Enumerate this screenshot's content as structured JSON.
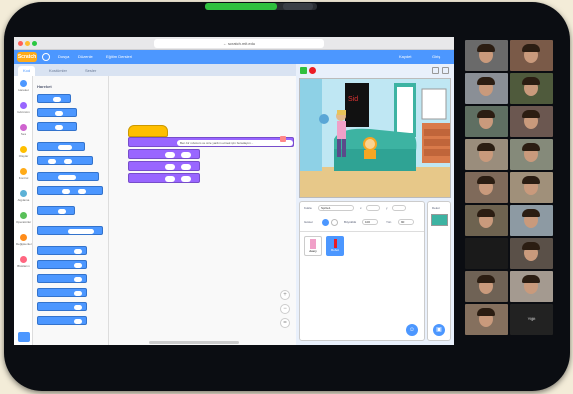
{
  "browser": {
    "url": "← scratch.mit.edu"
  },
  "menubar": {
    "logo": "Scratch",
    "items": [
      "Dosya",
      "Düzenle",
      "Eğitim Dersleri"
    ],
    "right_items": [
      "Kaydet",
      "Giriş"
    ]
  },
  "tabs": [
    "Kod",
    "Kostümler",
    "Sesler"
  ],
  "categories": [
    {
      "name": "Hareket",
      "color": "#4c97ff"
    },
    {
      "name": "Görünüm",
      "color": "#9966ff"
    },
    {
      "name": "Ses",
      "color": "#cf63cf"
    },
    {
      "name": "Olaylar",
      "color": "#ffbf00"
    },
    {
      "name": "Kontrol",
      "color": "#ffab19"
    },
    {
      "name": "Algılama",
      "color": "#5cb1d6"
    },
    {
      "name": "Operatörler",
      "color": "#59c059"
    },
    {
      "name": "Değişkenler",
      "color": "#ff8c1a"
    },
    {
      "name": "Bloklarım",
      "color": "#ff6680"
    }
  ],
  "palette": {
    "title": "Hareket"
  },
  "script": {
    "hat_label": "bayrak tıklandığında",
    "say_text": "Ben bir robotum ve size yardım etmek için buradayım..."
  },
  "sprite_panel": {
    "sprite_label": "Kukla",
    "sprite_name": "Sprite1",
    "x_label": "x",
    "y_label": "y",
    "show_label": "Göster",
    "size_label": "Büyüklük",
    "size_value": "100",
    "direction_label": "Yön",
    "direction_value": "90",
    "sprites": [
      "Avery",
      "Robot"
    ]
  },
  "backdrop_panel": {
    "label": "Dekor"
  },
  "participants": [
    {
      "name": "",
      "bg": "#6a6a6a"
    },
    {
      "name": "",
      "bg": "#7a5a48"
    },
    {
      "name": "",
      "bg": "#8a8f96"
    },
    {
      "name": "",
      "bg": "#4f5a3c"
    },
    {
      "name": "",
      "bg": "#5f6f62"
    },
    {
      "name": "",
      "bg": "#6b5750"
    },
    {
      "name": "",
      "bg": "#9a8d7c"
    },
    {
      "name": "",
      "bg": "#858a7a"
    },
    {
      "name": "",
      "bg": "#7f6a5a"
    },
    {
      "name": "",
      "bg": "#a0907a"
    },
    {
      "name": "",
      "bg": "#6e6350"
    },
    {
      "name": "",
      "bg": "#8d9aa3"
    },
    {
      "name": "",
      "bg": "#1a1a1a"
    },
    {
      "name": "",
      "bg": "#5a5048"
    },
    {
      "name": "",
      "bg": "#6f6255"
    },
    {
      "name": "",
      "bg": "#a49a90"
    },
    {
      "name": "",
      "bg": "#85705e"
    },
    {
      "name": "",
      "bg": "#222222"
    }
  ],
  "participant_name_tile": "Yiğit",
  "colors": {
    "scratch_blue": "#4c97ff",
    "looks_purple": "#9966ff",
    "events_yellow": "#ffbf00"
  }
}
